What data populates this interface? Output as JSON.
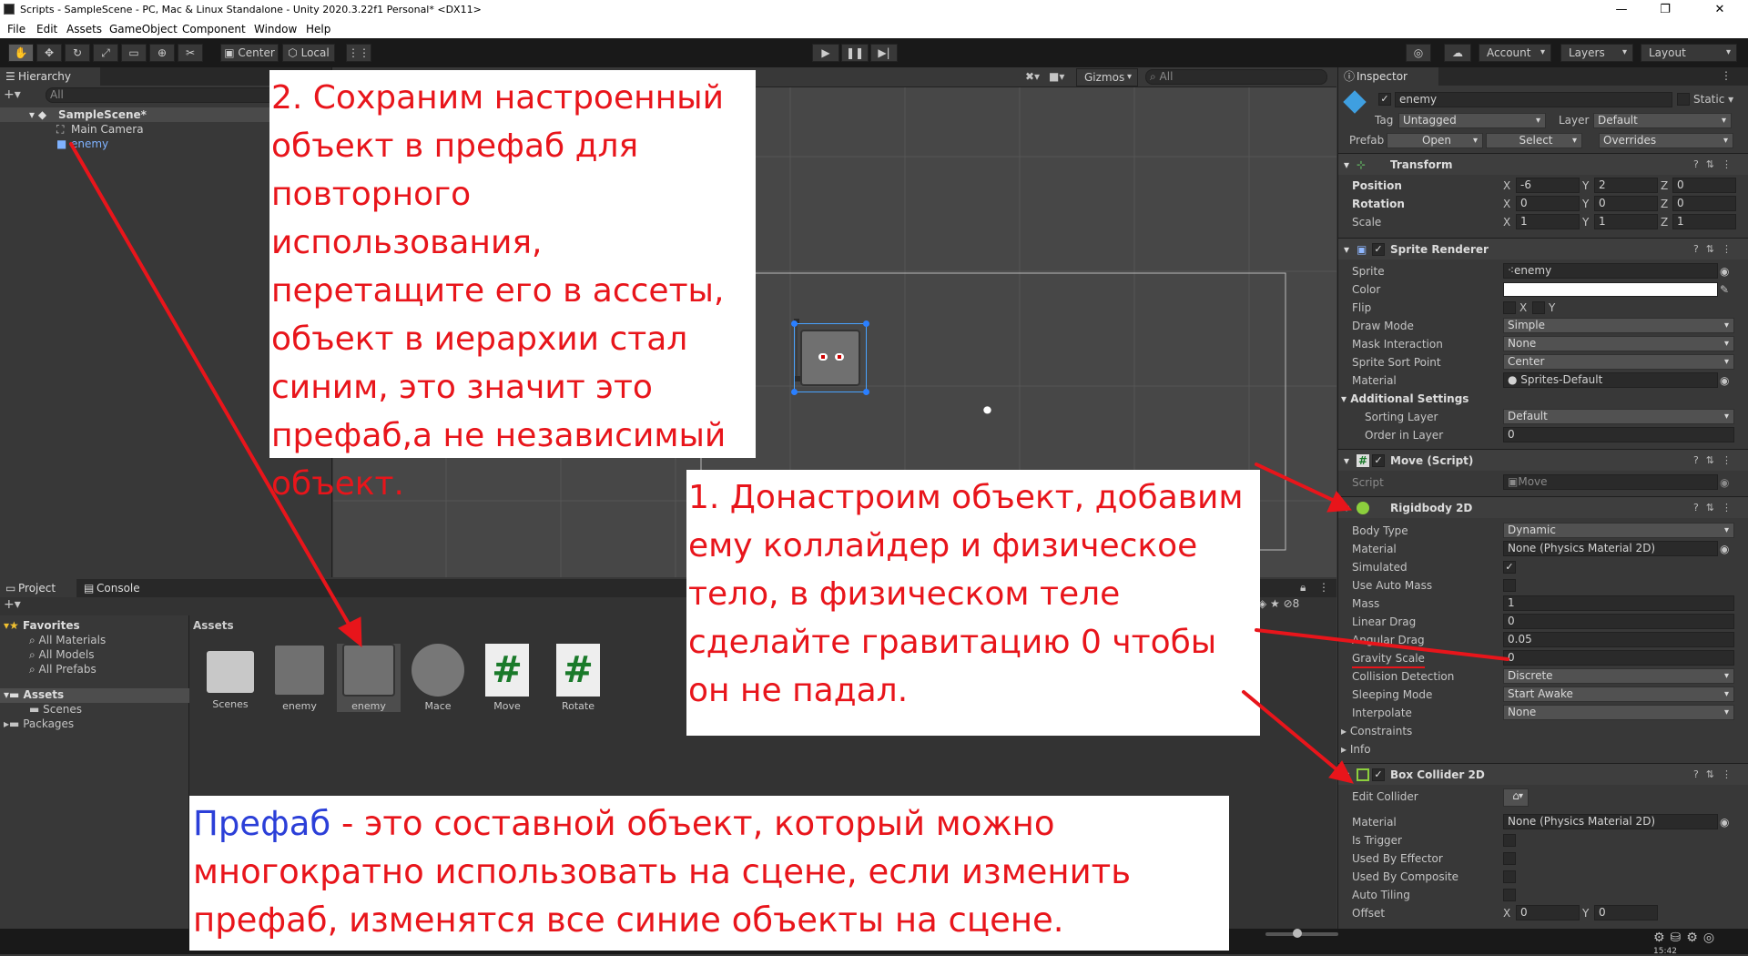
{
  "window": {
    "title": "Scripts - SampleScene - PC, Mac & Linux Standalone - Unity 2020.3.22f1 Personal* <DX11>"
  },
  "menu": [
    "File",
    "Edit",
    "Assets",
    "GameObject",
    "Component",
    "Window",
    "Help"
  ],
  "toolbar": {
    "pivot": "Center",
    "space": "Local",
    "account": "Account",
    "layers": "Layers",
    "layout": "Layout"
  },
  "hierarchy": {
    "tab": "Hierarchy",
    "search_placeholder": "All",
    "items": [
      "SampleScene*",
      "Main Camera",
      "enemy"
    ]
  },
  "scene": {
    "gizmos": "Gizmos",
    "search_placeholder": "All"
  },
  "project": {
    "tab_project": "Project",
    "tab_console": "Console",
    "favorites_label": "Favorites",
    "favorites": [
      "All Materials",
      "All Models",
      "All Prefabs"
    ],
    "tree": [
      "Assets",
      "Scenes",
      "Packages"
    ],
    "breadcrumb": "Assets",
    "hidden_count": "8",
    "assets": [
      {
        "name": "Scenes",
        "kind": "folder"
      },
      {
        "name": "enemy",
        "kind": "sprite"
      },
      {
        "name": "enemy",
        "kind": "prefab"
      },
      {
        "name": "Mace",
        "kind": "sprite"
      },
      {
        "name": "Move",
        "kind": "script"
      },
      {
        "name": "Rotate",
        "kind": "script"
      }
    ]
  },
  "inspector": {
    "tab": "Inspector",
    "object_name": "enemy",
    "static": "Static",
    "tag_label": "Tag",
    "tag": "Untagged",
    "layer_label": "Layer",
    "layer": "Default",
    "prefab_label": "Prefab",
    "prefab_open": "Open",
    "prefab_select": "Select",
    "prefab_overrides": "Overrides",
    "transform": {
      "title": "Transform",
      "position_label": "Position",
      "position": {
        "x": "-6",
        "y": "2",
        "z": "0"
      },
      "rotation_label": "Rotation",
      "rotation": {
        "x": "0",
        "y": "0",
        "z": "0"
      },
      "scale_label": "Scale",
      "scale": {
        "x": "1",
        "y": "1",
        "z": "1"
      }
    },
    "sprite_renderer": {
      "title": "Sprite Renderer",
      "sprite_label": "Sprite",
      "sprite": "enemy",
      "color_label": "Color",
      "flip_label": "Flip",
      "flip_x": "X",
      "flip_y": "Y",
      "draw_mode_label": "Draw Mode",
      "draw_mode": "Simple",
      "mask_label": "Mask Interaction",
      "mask": "None",
      "sort_point_label": "Sprite Sort Point",
      "sort_point": "Center",
      "material_label": "Material",
      "material": "Sprites-Default",
      "additional_label": "Additional Settings",
      "sorting_layer_label": "Sorting Layer",
      "sorting_layer": "Default",
      "order_label": "Order in Layer",
      "order": "0"
    },
    "move_script": {
      "title": "Move (Script)",
      "script_label": "Script",
      "script": "Move"
    },
    "rigidbody": {
      "title": "Rigidbody 2D",
      "body_type_label": "Body Type",
      "body_type": "Dynamic",
      "material_label": "Material",
      "material": "None (Physics Material 2D)",
      "simulated_label": "Simulated",
      "auto_mass_label": "Use Auto Mass",
      "mass_label": "Mass",
      "mass": "1",
      "linear_drag_label": "Linear Drag",
      "linear_drag": "0",
      "angular_drag_label": "Angular Drag",
      "angular_drag": "0.05",
      "gravity_label": "Gravity Scale",
      "gravity": "0",
      "collision_label": "Collision Detection",
      "collision": "Discrete",
      "sleeping_label": "Sleeping Mode",
      "sleeping": "Start Awake",
      "interpolate_label": "Interpolate",
      "interpolate": "None",
      "constraints_label": "Constraints",
      "info_label": "Info"
    },
    "box_collider": {
      "title": "Box Collider 2D",
      "edit_label": "Edit Collider",
      "material_label": "Material",
      "material": "None (Physics Material 2D)",
      "trigger_label": "Is Trigger",
      "effector_label": "Used By Effector",
      "composite_label": "Used By Composite",
      "tiling_label": "Auto Tiling",
      "offset_label": "Offset",
      "offset_x": "0",
      "offset_y": "0"
    }
  },
  "annotations": {
    "note2": "2. Сохраним настроенный объект в префаб для повторного использования, перетащите его в ассеты, объект в иерархии стал синим, это значит это префаб,а не независимый объект.",
    "note1": "1. Донастроим объект, добавим ему коллайдер и физическое тело, в физическом теле сделайте гравитацию 0 чтобы он не падал.",
    "note3_term": "Префаб",
    "note3_rest": " - это составной объект, который можно многократно использовать на сцене, если изменить префаб, изменятся все синие объекты на сцене."
  },
  "colors": {
    "annotation_red": "#e8151b",
    "annotation_blue": "#2b3fd8",
    "prefab_blue": "#7fb2ff"
  },
  "status": {
    "clock": "15:42"
  }
}
